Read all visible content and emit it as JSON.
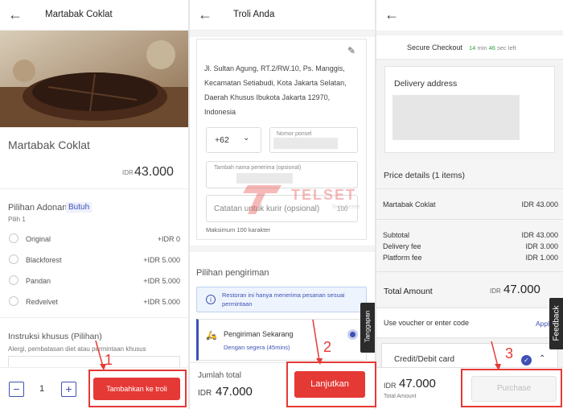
{
  "p1": {
    "title": "Martabak Coklat",
    "product_name": "Martabak Coklat",
    "currency": "IDR",
    "price": "43.000",
    "dough_label": "Pilihan Adonan",
    "dough_badge": "Butuh",
    "dough_hint": "Pilih 1",
    "options": [
      {
        "label": "Original",
        "price": "+IDR 0"
      },
      {
        "label": "Blackforest",
        "price": "+IDR 5.000"
      },
      {
        "label": "Pandan",
        "price": "+IDR 5.000"
      },
      {
        "label": "Redvelvet",
        "price": "+IDR 5.000"
      }
    ],
    "instructions_label": "Instruksi khusus (Pilihan)",
    "instructions_hint": "Alergi, pembatasan diet atau permintaan khusus",
    "qty": "1",
    "minus": "−",
    "plus": "+",
    "add_button": "Tambahkan ke troli",
    "annot": "1"
  },
  "p2": {
    "title": "Troli Anda",
    "address": "Jl. Sultan Agung, RT.2/RW.10, Ps. Manggis, Kecamatan Setiabudi, Kota Jakarta Selatan, Daerah Khusus Ibukota Jakarta 12970, Indonesia",
    "phone_code": "+62",
    "phone_label": "Nomor ponsel",
    "recipient_label": "Tambah nama penerima (opsional)",
    "courier_placeholder": "Catatan untuk kurir (opsional)",
    "courier_count": "100",
    "max_chars": "Maksimum 100 karakter",
    "delivery_options": "Pilihan pengiriman",
    "info": "Restoran ini hanya menerima pesanan sesuai permintaan",
    "delivery_now": "Pengiriman Sekarang",
    "delivery_sub": "Dengan segera (45mins)",
    "side_tab": "Tanggapan",
    "total_label": "Jumlah total",
    "currency": "IDR",
    "total": "47.000",
    "continue_button": "Lanjutkan",
    "annot": "2"
  },
  "p3": {
    "secure": "Secure Checkout",
    "timer_min": "14",
    "timer_min_unit": "min",
    "timer_sec": "46",
    "timer_sec_unit": "sec left",
    "delivery_address": "Delivery address",
    "price_details": "Price details (1 items)",
    "item_name": "Martabak Coklat",
    "item_price": "IDR 43.000",
    "subtotal_label": "Subtotal",
    "subtotal": "IDR 43.000",
    "delivery_fee_label": "Delivery fee",
    "delivery_fee": "IDR 3.000",
    "platform_fee_label": "Platform fee",
    "platform_fee": "IDR 1.000",
    "total_amount_label": "Total Amount",
    "currency": "IDR",
    "total": "47.000",
    "voucher": "Use voucher or enter code",
    "apply": "Apply",
    "card": "Credit/Debit card",
    "feedback": "Feedback",
    "bottom_total": "47.000",
    "bottom_total_label": "Total Amount",
    "purchase_button": "Purchase",
    "annot": "3"
  },
  "watermark": {
    "brand": "TELSET",
    "tagline": "Tech Better"
  },
  "colors": {
    "accent": "#e53935",
    "link_blue": "#3f51b5",
    "timer_green": "#2e9d3e",
    "info_bg": "#eef4fd"
  }
}
